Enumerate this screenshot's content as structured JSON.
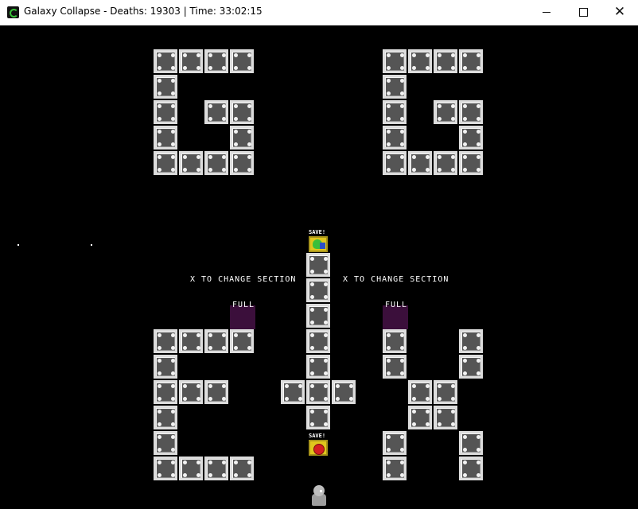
{
  "window": {
    "title": "Galaxy Collapse - Deaths: 19303 | Time: 33:02:15",
    "controls": {
      "minimize_icon": "minimize-icon",
      "maximize_icon": "maximize-icon",
      "close_icon": "close-icon",
      "close_glyph": "✕"
    }
  },
  "game": {
    "hints": {
      "left": "X TO CHANGE SECTION",
      "right": "X TO CHANGE SECTION"
    },
    "full_labels": {
      "left": "FULL",
      "right": "FULL"
    },
    "save_labels": {
      "top": "SAVE!",
      "bottom": "SAVE!"
    },
    "colors": {
      "background": "#000000",
      "block_face": "#555555",
      "block_border": "#dcdcdc",
      "full_zone": "#3b0f3b",
      "save_point": "#e0c61d"
    },
    "letter_tiles": {
      "G_left": "G",
      "G_right": "G",
      "E": "E",
      "plus": "+",
      "X": "X"
    }
  }
}
